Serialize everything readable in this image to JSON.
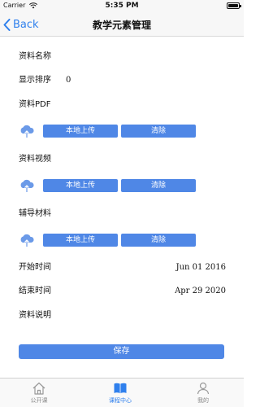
{
  "status_bar": {
    "carrier": "Carrier",
    "time": "5:35 PM"
  },
  "nav": {
    "back_label": "Back",
    "title": "教学元素管理"
  },
  "form": {
    "name_label": "资料名称",
    "order_label": "显示排序",
    "order_value": "0",
    "pdf_label": "资料PDF",
    "video_label": "资料视频",
    "aux_label": "辅导材料",
    "upload_local_label": "本地上传",
    "clear_label": "清除",
    "start_label": "开始时间",
    "start_value": "Jun 01 2016",
    "end_label": "结束时间",
    "end_value": "Apr 29 2020",
    "desc_label": "资料说明",
    "save_label": "保存"
  },
  "tabs": [
    {
      "label": "公开课",
      "icon": "home-icon",
      "active": false
    },
    {
      "label": "课程中心",
      "icon": "book-icon",
      "active": true
    },
    {
      "label": "我的",
      "icon": "person-icon",
      "active": false
    }
  ],
  "colors": {
    "accent": "#2f80ed",
    "button": "#4f87e6",
    "cloud": "#6b9ae8"
  }
}
